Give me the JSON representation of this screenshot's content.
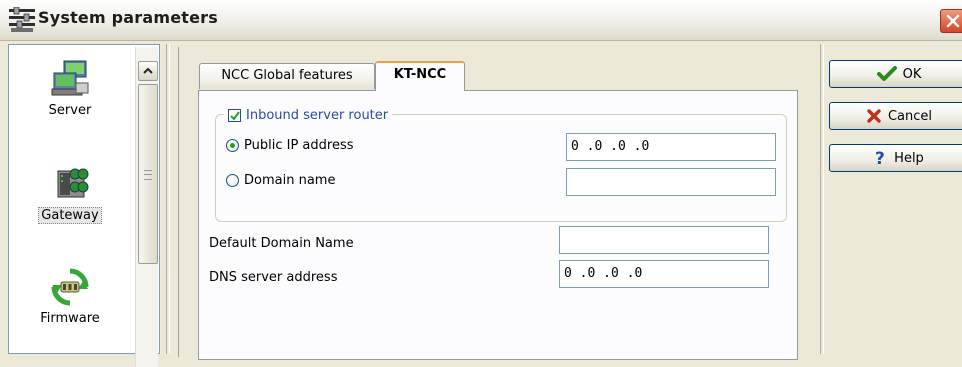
{
  "window": {
    "title": "System parameters"
  },
  "sidebar": {
    "items": [
      {
        "label": "Server",
        "icon": "server-icon"
      },
      {
        "label": "Gateway",
        "icon": "gateway-icon",
        "selected": true
      },
      {
        "label": "Firmware",
        "icon": "firmware-icon"
      }
    ]
  },
  "tabs": [
    {
      "label": "NCC Global features",
      "active": false
    },
    {
      "label": "KT-NCC",
      "active": true
    }
  ],
  "group": {
    "title": "Inbound server router",
    "checked": true,
    "options": [
      {
        "label": "Public IP address",
        "selected": true,
        "value": "0 .0 .0 .0"
      },
      {
        "label": "Domain name",
        "selected": false,
        "value": ""
      }
    ]
  },
  "fields": {
    "default_domain": {
      "label": "Default Domain Name",
      "value": ""
    },
    "dns_server": {
      "label": "DNS server address",
      "value": "0 .0 .0 .0"
    }
  },
  "buttons": {
    "ok": "OK",
    "cancel": "Cancel",
    "help": "Help"
  },
  "colors": {
    "accent_tab": "#e8a33d",
    "legend_text": "#2b49a8",
    "ok_check": "#2c8a1c",
    "cancel_x": "#c0311a",
    "close_red": "#d6452a"
  }
}
